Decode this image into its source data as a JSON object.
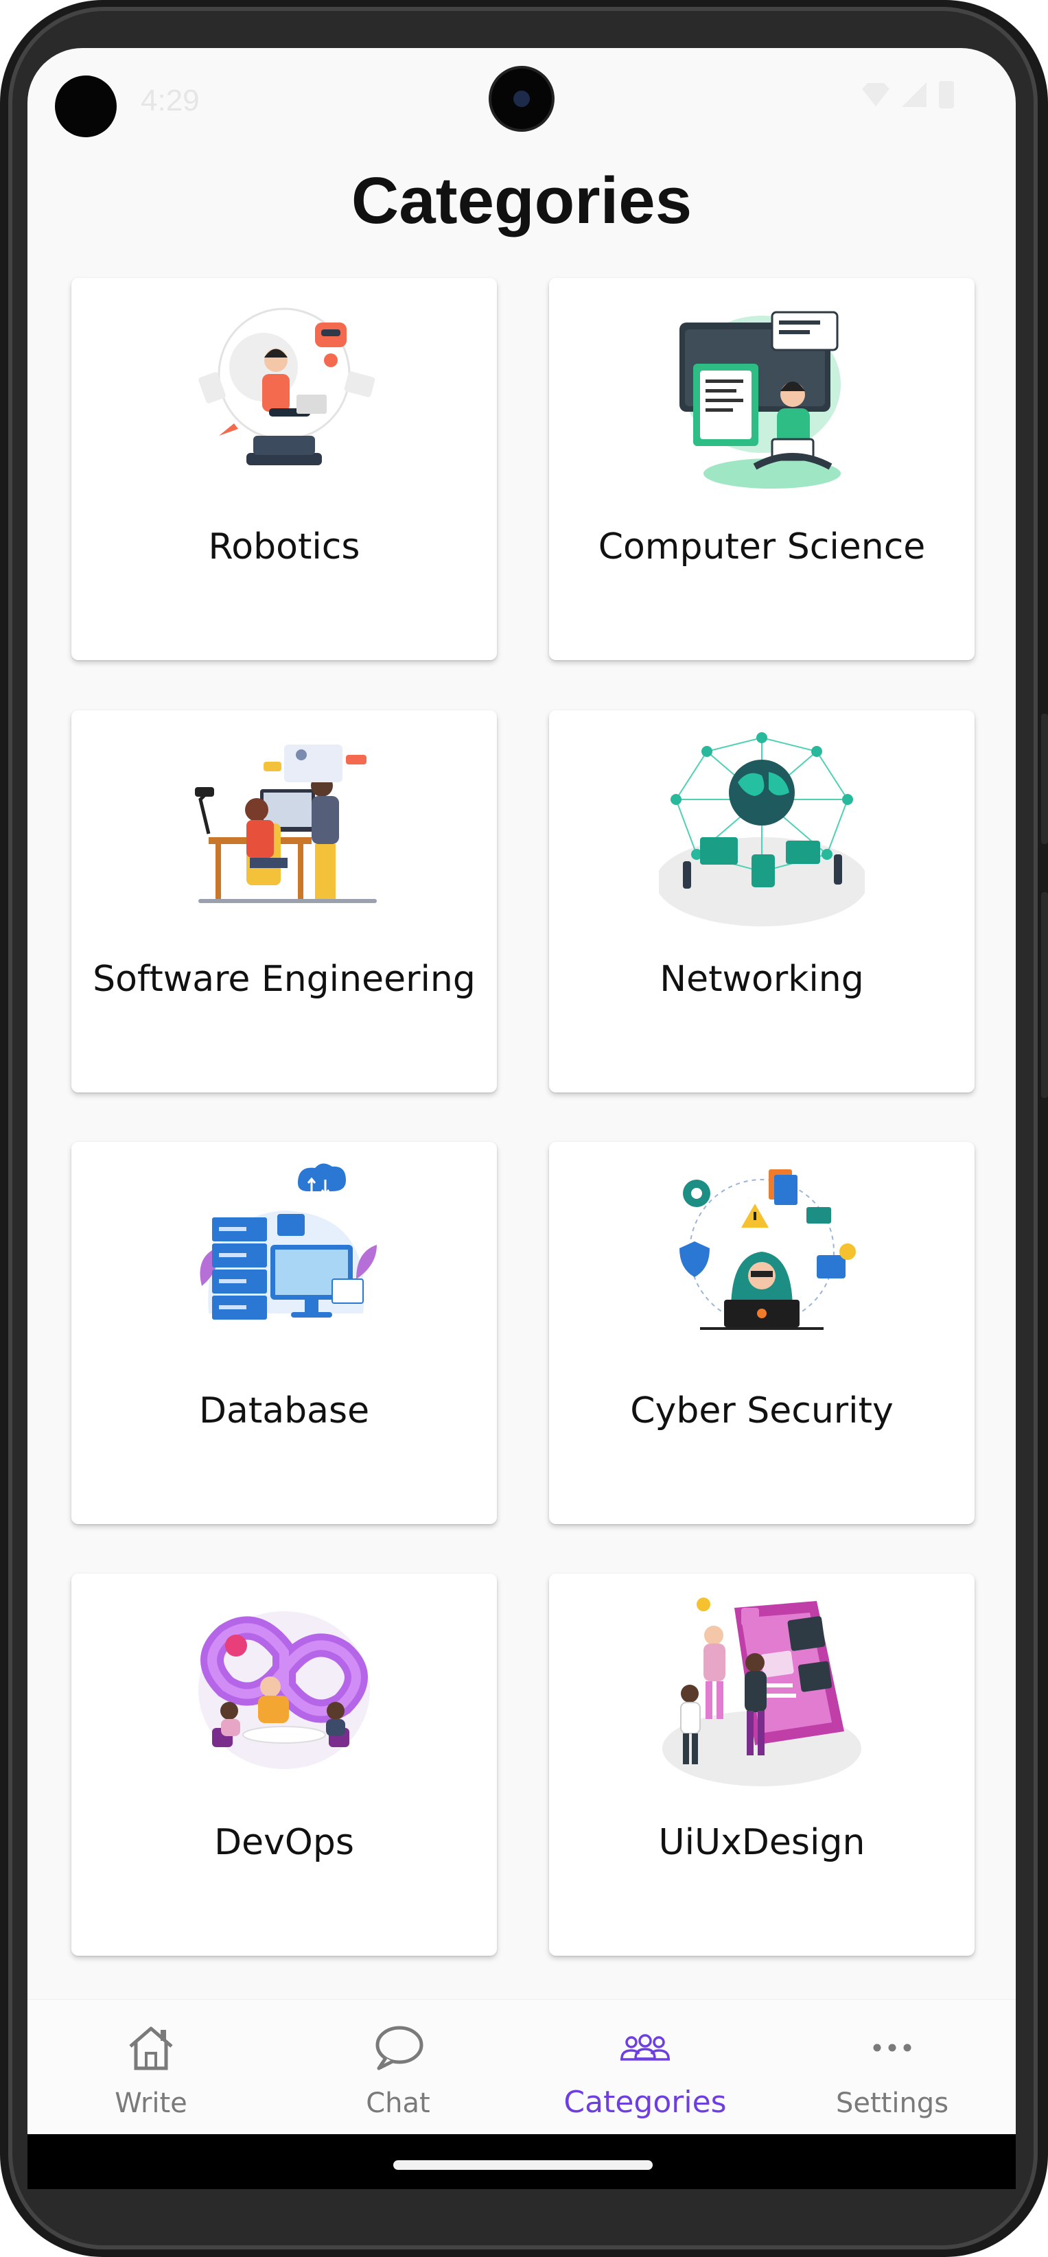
{
  "status_bar": {
    "time": "4:29"
  },
  "header": {
    "title": "Categories"
  },
  "categories": [
    {
      "label": "Robotics",
      "illustration": "robotics-illustration"
    },
    {
      "label": "Computer Science",
      "illustration": "computer-science-illustration"
    },
    {
      "label": "Software Engineering",
      "illustration": "software-engineering-illustration"
    },
    {
      "label": "Networking",
      "illustration": "networking-illustration"
    },
    {
      "label": "Database",
      "illustration": "database-illustration"
    },
    {
      "label": "Cyber Security",
      "illustration": "cyber-security-illustration"
    },
    {
      "label": "DevOps",
      "illustration": "devops-illustration"
    },
    {
      "label": "UiUxDesign",
      "illustration": "uiux-design-illustration"
    }
  ],
  "bottom_nav": {
    "items": [
      {
        "label": "Write",
        "icon": "home-icon",
        "active": false
      },
      {
        "label": "Chat",
        "icon": "chat-bubble-icon",
        "active": false
      },
      {
        "label": "Categories",
        "icon": "people-group-icon",
        "active": true
      },
      {
        "label": "Settings",
        "icon": "more-dots-icon",
        "active": false
      }
    ]
  },
  "colors": {
    "accent": "#6d3ee0",
    "inactive": "#7a7a7a",
    "background": "#f9f9f9",
    "card": "#ffffff"
  }
}
